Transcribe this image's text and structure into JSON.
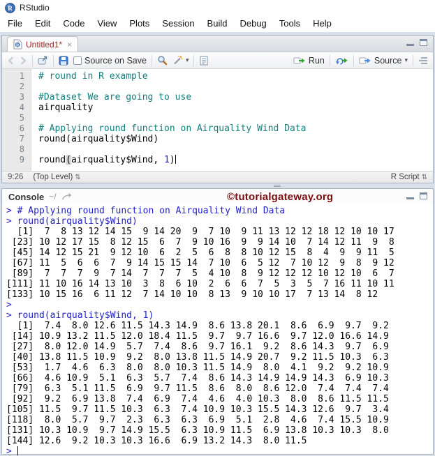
{
  "window": {
    "title": "RStudio"
  },
  "menu": {
    "items": [
      "File",
      "Edit",
      "Code",
      "View",
      "Plots",
      "Session",
      "Build",
      "Debug",
      "Tools",
      "Help"
    ]
  },
  "icons": {
    "close": "×",
    "updown": "⇅",
    "caret_down": "▾"
  },
  "colors": {
    "comment_teal": "#158080",
    "console_input_blue": "#2222cc",
    "number_blue": "#1d1dd0",
    "tab_title_maroon": "#9c2525",
    "watermark_maroon": "#7b0c10",
    "run_arrow_green": "#34a02c",
    "source_arrow_blue": "#4a90d9"
  },
  "source_pane": {
    "tab": {
      "label": "Untitled1*"
    },
    "toolbar": {
      "source_on_save_label": "Source on Save",
      "run_label": "Run",
      "source_label": "Source"
    },
    "editor": {
      "lines": [
        {
          "n": 1,
          "segments": [
            {
              "t": "# round in R example",
              "cls": "comment"
            }
          ]
        },
        {
          "n": 2,
          "segments": []
        },
        {
          "n": 3,
          "segments": [
            {
              "t": "#Dataset We are going to use",
              "cls": "comment"
            }
          ]
        },
        {
          "n": 4,
          "segments": [
            {
              "t": "airquality",
              "cls": "code"
            }
          ]
        },
        {
          "n": 5,
          "segments": []
        },
        {
          "n": 6,
          "segments": [
            {
              "t": "# Applying round function on Airquality Wind Data",
              "cls": "comment"
            }
          ]
        },
        {
          "n": 7,
          "segments": [
            {
              "t": "round(airquality$Wind)",
              "cls": "code"
            }
          ]
        },
        {
          "n": 8,
          "segments": []
        },
        {
          "n": 9,
          "segments": [
            {
              "t": "round",
              "cls": "code"
            },
            {
              "t": "(",
              "cls": "paren"
            },
            {
              "t": "airquality$Wind, ",
              "cls": "code"
            },
            {
              "t": "1",
              "cls": "number"
            },
            {
              "t": ")",
              "cls": "code"
            },
            {
              "t": "",
              "cls": "cursor"
            }
          ]
        }
      ]
    },
    "status_bar": {
      "position": "9:26",
      "scope": "(Top Level)",
      "file_type": "R Script"
    }
  },
  "console": {
    "title": "Console",
    "path": "~/",
    "watermark": "©tutorialgateway.org",
    "lines": [
      {
        "type": "input",
        "text": "> # Applying round function on Airquality Wind Data"
      },
      {
        "type": "input",
        "text": "> round(airquality$Wind)"
      },
      {
        "type": "output",
        "text": "  [1]  7  8 13 12 14 15  9 14 20  9  7 10  9 11 13 12 12 18 12 10 10 17"
      },
      {
        "type": "output",
        "text": " [23] 10 12 17 15  8 12 15  6  7  9 10 16  9  9 14 10  7 14 12 11  9  8"
      },
      {
        "type": "output",
        "text": " [45] 14 12 15 21  9 12 10  6  2  5  6  8  8 10 12 15  8  4  9  9 11  5"
      },
      {
        "type": "output",
        "text": " [67] 11  5  6  6  7  9 14 15 15 14  7 10  6  5 12  7 10 12  9  8  9 12"
      },
      {
        "type": "output",
        "text": " [89]  7  7  7  9  7 14  7  7  7  5  4 10  8  9 12 12 12 10 12 10  6  7"
      },
      {
        "type": "output",
        "text": "[111] 11 10 16 14 13 10  3  8  6 10  2  6  6  7  5  3  5  7 16 11 10 11"
      },
      {
        "type": "output",
        "text": "[133] 10 15 16  6 11 12  7 14 10 10  8 13  9 10 10 17  7 13 14  8 12"
      },
      {
        "type": "input",
        "text": ">"
      },
      {
        "type": "input",
        "text": "> round(airquality$Wind, 1)"
      },
      {
        "type": "output",
        "text": "  [1]  7.4  8.0 12.6 11.5 14.3 14.9  8.6 13.8 20.1  8.6  6.9  9.7  9.2"
      },
      {
        "type": "output",
        "text": " [14] 10.9 13.2 11.5 12.0 18.4 11.5  9.7  9.7 16.6  9.7 12.0 16.6 14.9"
      },
      {
        "type": "output",
        "text": " [27]  8.0 12.0 14.9  5.7  7.4  8.6  9.7 16.1  9.2  8.6 14.3  9.7  6.9"
      },
      {
        "type": "output",
        "text": " [40] 13.8 11.5 10.9  9.2  8.0 13.8 11.5 14.9 20.7  9.2 11.5 10.3  6.3"
      },
      {
        "type": "output",
        "text": " [53]  1.7  4.6  6.3  8.0  8.0 10.3 11.5 14.9  8.0  4.1  9.2  9.2 10.9"
      },
      {
        "type": "output",
        "text": " [66]  4.6 10.9  5.1  6.3  5.7  7.4  8.6 14.3 14.9 14.9 14.3  6.9 10.3"
      },
      {
        "type": "output",
        "text": " [79]  6.3  5.1 11.5  6.9  9.7 11.5  8.6  8.0  8.6 12.0  7.4  7.4  7.4"
      },
      {
        "type": "output",
        "text": " [92]  9.2  6.9 13.8  7.4  6.9  7.4  4.6  4.0 10.3  8.0  8.6 11.5 11.5"
      },
      {
        "type": "output",
        "text": "[105] 11.5  9.7 11.5 10.3  6.3  7.4 10.9 10.3 15.5 14.3 12.6  9.7  3.4"
      },
      {
        "type": "output",
        "text": "[118]  8.0  5.7  9.7  2.3  6.3  6.3  6.9  5.1  2.8  4.6  7.4 15.5 10.9"
      },
      {
        "type": "output",
        "text": "[131] 10.3 10.9  9.7 14.9 15.5  6.3 10.9 11.5  6.9 13.8 10.3 10.3  8.0"
      },
      {
        "type": "output",
        "text": "[144] 12.6  9.2 10.3 10.3 16.6  6.9 13.2 14.3  8.0 11.5"
      },
      {
        "type": "input",
        "text": "> ",
        "cursor": true
      }
    ]
  }
}
